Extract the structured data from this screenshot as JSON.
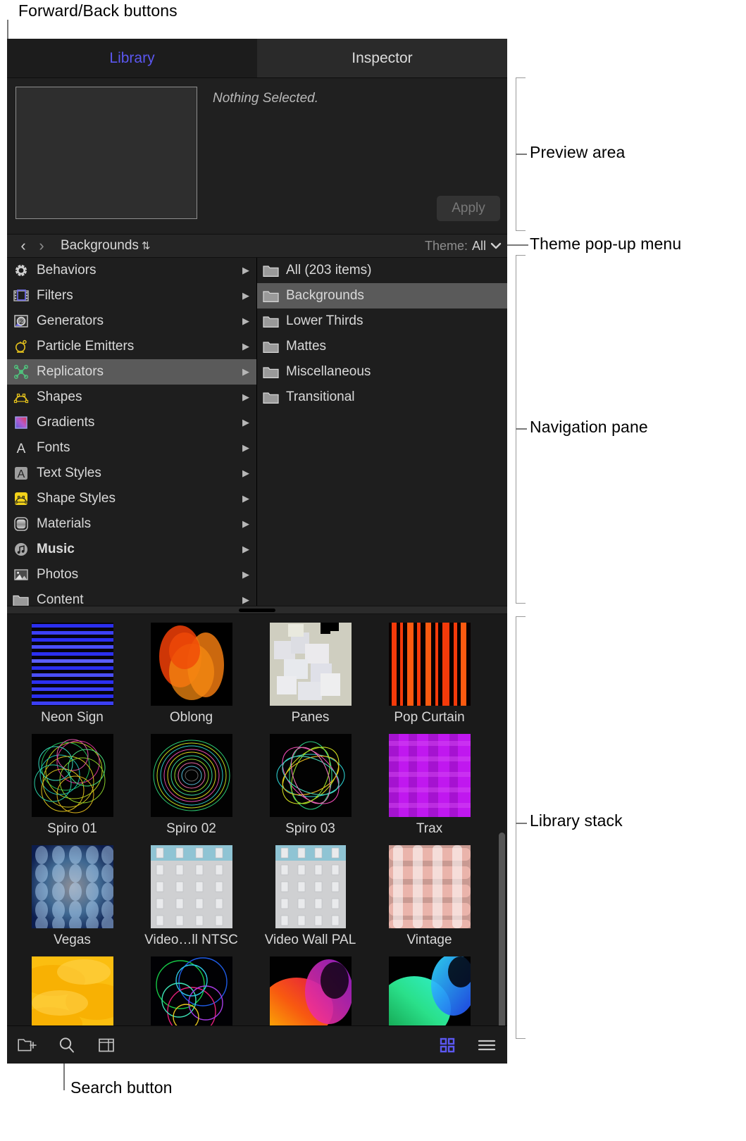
{
  "annotations": {
    "forward_back": "Forward/Back buttons",
    "preview_area": "Preview area",
    "theme_popup": "Theme pop-up menu",
    "navigation_pane": "Navigation pane",
    "library_stack": "Library stack",
    "search_button": "Search button"
  },
  "tabs": [
    {
      "label": "Library",
      "active": true
    },
    {
      "label": "Inspector",
      "active": false
    }
  ],
  "preview": {
    "status": "Nothing Selected.",
    "apply_label": "Apply"
  },
  "pathbar": {
    "back_glyph": "‹",
    "forward_glyph": "›",
    "path": "Backgrounds",
    "sort_glyph": "⇅",
    "theme_label": "Theme:",
    "theme_value": "All",
    "chevron": "⌄"
  },
  "sidebar": {
    "items": [
      {
        "label": "Behaviors",
        "icon": "gear-icon",
        "selected": false,
        "bold": false
      },
      {
        "label": "Filters",
        "icon": "filmstrip-icon",
        "selected": false,
        "bold": false
      },
      {
        "label": "Generators",
        "icon": "generator-icon",
        "selected": false,
        "bold": false
      },
      {
        "label": "Particle Emitters",
        "icon": "particle-emitter-icon",
        "selected": false,
        "bold": false
      },
      {
        "label": "Replicators",
        "icon": "replicator-icon",
        "selected": true,
        "bold": false
      },
      {
        "label": "Shapes",
        "icon": "shape-curve-icon",
        "selected": false,
        "bold": false
      },
      {
        "label": "Gradients",
        "icon": "gradient-swatch-icon",
        "selected": false,
        "bold": false
      },
      {
        "label": "Fonts",
        "icon": "letter-a-icon",
        "selected": false,
        "bold": false
      },
      {
        "label": "Text Styles",
        "icon": "text-style-icon",
        "selected": false,
        "bold": false
      },
      {
        "label": "Shape Styles",
        "icon": "shape-style-icon",
        "selected": false,
        "bold": false
      },
      {
        "label": "Materials",
        "icon": "material-sphere-icon",
        "selected": false,
        "bold": false
      },
      {
        "label": "Music",
        "icon": "music-note-icon",
        "selected": false,
        "bold": true
      },
      {
        "label": "Photos",
        "icon": "photo-icon",
        "selected": false,
        "bold": false
      },
      {
        "label": "Content",
        "icon": "folder-icon",
        "selected": false,
        "bold": false
      }
    ],
    "disclosure_glyph": "▶"
  },
  "folders": {
    "items": [
      {
        "label": "All (203 items)",
        "selected": false
      },
      {
        "label": "Backgrounds",
        "selected": true
      },
      {
        "label": "Lower Thirds",
        "selected": false
      },
      {
        "label": "Mattes",
        "selected": false
      },
      {
        "label": "Miscellaneous",
        "selected": false
      },
      {
        "label": "Transitional",
        "selected": false
      }
    ]
  },
  "library_stack": {
    "items": [
      {
        "label": "Neon Sign",
        "thumb": "neon-sign"
      },
      {
        "label": "Oblong",
        "thumb": "oblong"
      },
      {
        "label": "Panes",
        "thumb": "panes"
      },
      {
        "label": "Pop Curtain",
        "thumb": "pop-curtain"
      },
      {
        "label": "Spiro 01",
        "thumb": "spiro01"
      },
      {
        "label": "Spiro 02",
        "thumb": "spiro02"
      },
      {
        "label": "Spiro 03",
        "thumb": "spiro03"
      },
      {
        "label": "Trax",
        "thumb": "trax"
      },
      {
        "label": "Vegas",
        "thumb": "vegas"
      },
      {
        "label": "Video…ll NTSC",
        "thumb": "videowall-ntsc"
      },
      {
        "label": "Video Wall PAL",
        "thumb": "videowall-pal"
      },
      {
        "label": "Vintage",
        "thumb": "vintage"
      },
      {
        "label": "",
        "thumb": "yellow-waves"
      },
      {
        "label": "",
        "thumb": "rainbow-spiro"
      },
      {
        "label": "",
        "thumb": "warm-spiro"
      },
      {
        "label": "",
        "thumb": "green-spiro"
      }
    ]
  },
  "toolbar": {
    "new_folder": "new-folder-icon",
    "search": "search-icon",
    "sidebar_toggle": "panel-toggle-icon",
    "grid_view": "grid-view-icon",
    "list_view": "list-view-icon"
  },
  "colors": {
    "accent": "#5b57f0",
    "panel_bg": "#1e1e1e",
    "selection": "#5a5a5a",
    "text": "#d9d9d9"
  }
}
